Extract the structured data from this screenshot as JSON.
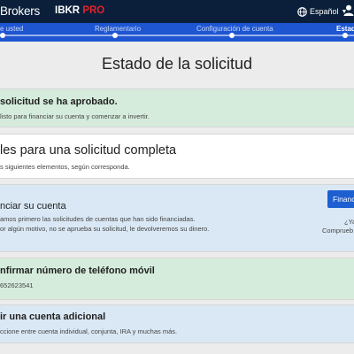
{
  "header": {
    "brand": "Brokers",
    "product_main": "IBKR ",
    "product_pro": "PRO",
    "language": "Español",
    "colors": {
      "bar": "#0b1f3a",
      "pro": "#e4212b"
    }
  },
  "progress": {
    "steps": [
      "e usted",
      "Reglamentario",
      "Configuración de cuenta",
      "Estad"
    ]
  },
  "page_title": "Estado de la solicitud",
  "cards": {
    "approved": {
      "title": "solicitud se ha aprobado.",
      "text": "listo para financiar su cuenta y comenzar a invertir."
    },
    "complete": {
      "title": "les para una solicitud completa",
      "text": "s siguientes elementos, según corresponda."
    },
    "fund": {
      "title": "nciar su cuenta",
      "text1": "amos primero las solicitudes de cuentas que han sido financiadas.",
      "text2": "or algún motivo, no se aprueba su solicitud, le devolveremos su dinero.",
      "button": "Financ",
      "side1": "¿Ya",
      "side2": "Comprueb"
    },
    "phone": {
      "title": "nfirmar número de teléfono móvil",
      "text": "652623541"
    },
    "additional": {
      "title": "ir una cuenta adicional",
      "text": "ccione entre cuenta individual, conjunta, IRA y muchas más."
    }
  }
}
